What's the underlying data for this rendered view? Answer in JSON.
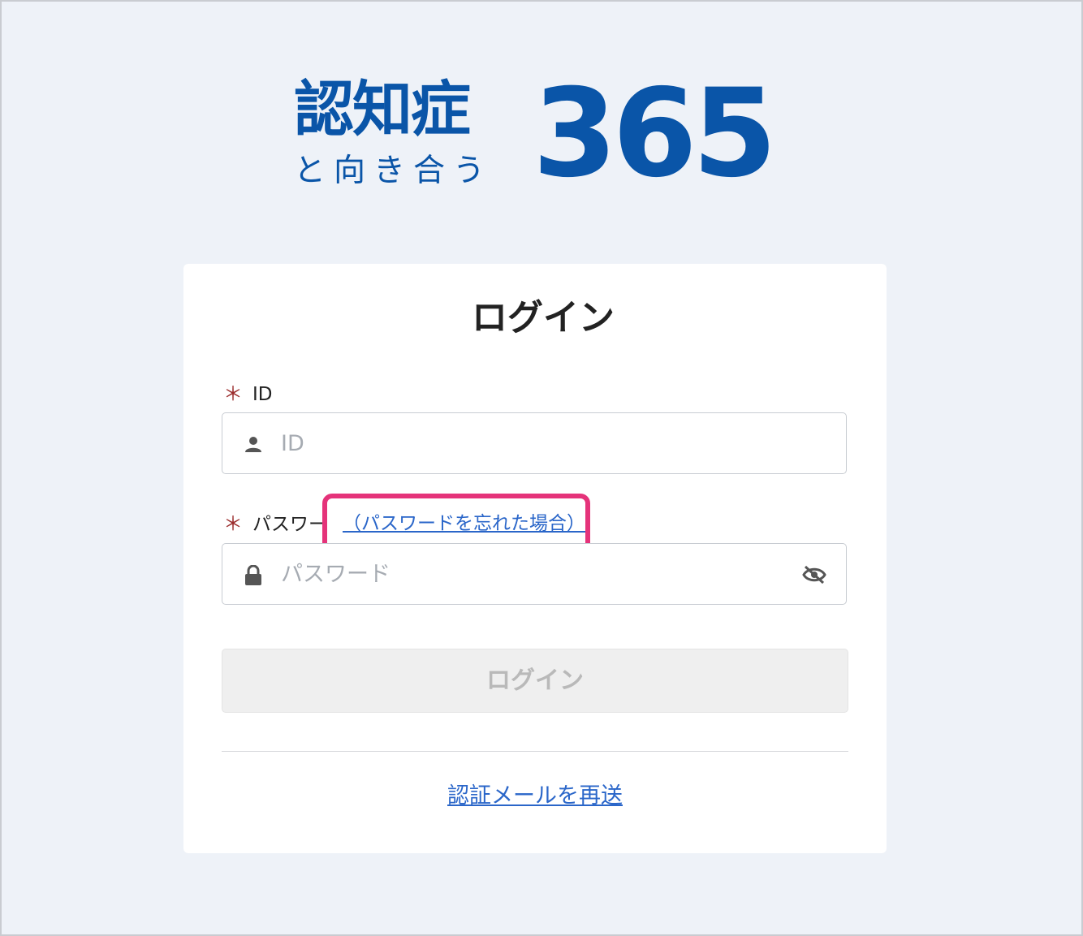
{
  "logo": {
    "main": "認知症",
    "sub": "と向き合う",
    "number": "365"
  },
  "login": {
    "title": "ログイン",
    "id_label": "ID",
    "id_placeholder": "ID",
    "password_label": "パスワード",
    "forgot_password": "（パスワードを忘れた場合）",
    "password_placeholder": "パスワード",
    "required_mark": "＊",
    "login_button": "ログイン",
    "resend_link": "認証メールを再送"
  },
  "colors": {
    "brand": "#0a55a8",
    "link": "#2a66c9",
    "highlight": "#e5337a",
    "required": "#9b2c2c"
  },
  "icons": [
    "user-icon",
    "lock-icon",
    "eye-off-icon"
  ]
}
